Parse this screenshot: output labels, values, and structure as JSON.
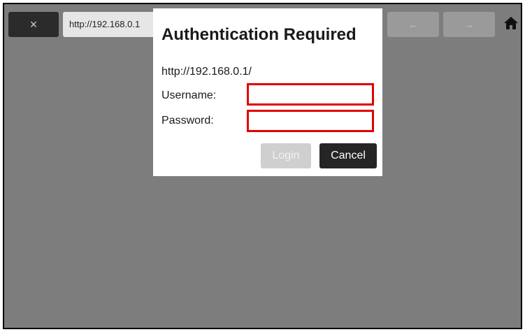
{
  "toolbar": {
    "close_glyph": "×",
    "url": "http://192.168.0.1",
    "back_glyph": "←",
    "forward_glyph": "→",
    "home_icon": "home-icon"
  },
  "dialog": {
    "title": "Authentication Required",
    "url": "http://192.168.0.1/",
    "username_label": "Username:",
    "password_label": "Password:",
    "username_value": "",
    "password_value": "",
    "login_label": "Login",
    "cancel_label": "Cancel"
  },
  "colors": {
    "page_overlay": "#7d7d7d",
    "field_highlight": "#e00000",
    "cancel_bg": "#252525",
    "login_disabled_bg": "#cfcfcf"
  }
}
